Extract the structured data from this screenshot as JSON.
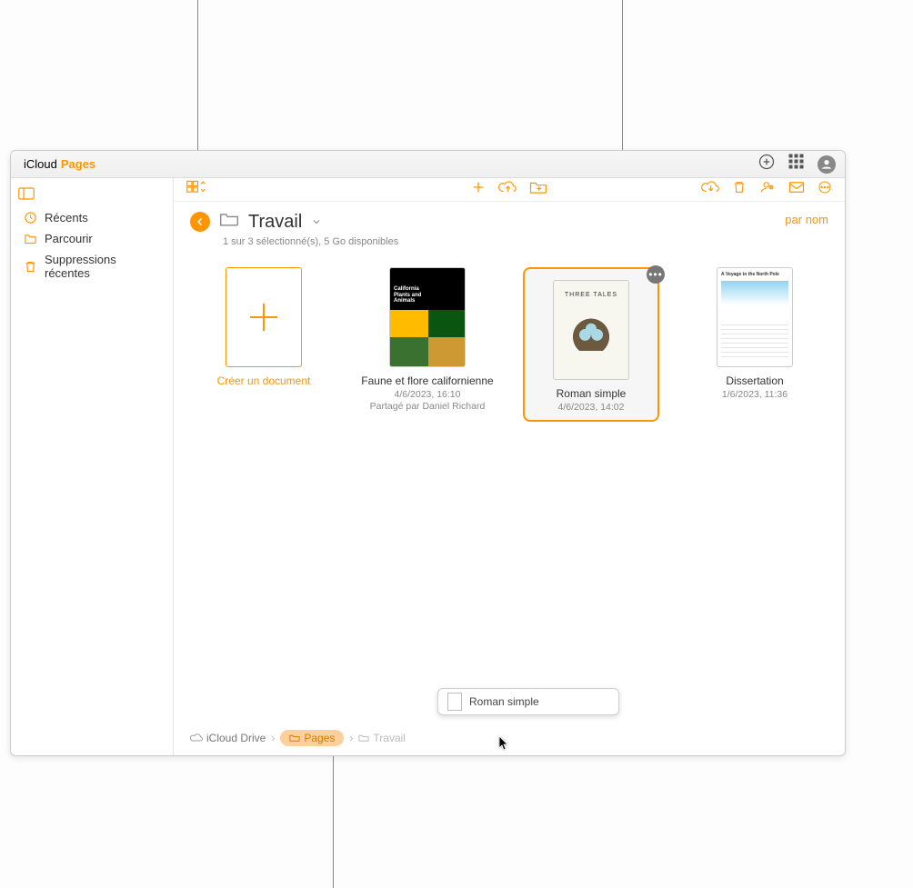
{
  "brand": {
    "icloud": "iCloud",
    "pages": "Pages"
  },
  "sidebar": {
    "recents": "Récents",
    "browse": "Parcourir",
    "deleted": "Suppressions récentes"
  },
  "folder": {
    "name": "Travail",
    "status": "1 sur 3 sélectionné(s), 5 Go disponibles"
  },
  "sort": "par nom",
  "tiles": {
    "create": "Créer un document",
    "faune": {
      "title": "Faune et flore californienne",
      "date": "4/6/2023, 16:10",
      "shared": "Partagé par Daniel Richard",
      "thumb_text": "California Plants and Animals"
    },
    "roman": {
      "title": "Roman simple",
      "date": "4/6/2023, 14:02",
      "thumb_text": "THREE TALES"
    },
    "diss": {
      "title": "Dissertation",
      "date": "1/6/2023, 11:36",
      "thumb_text": "A Voyage to the North Pole"
    }
  },
  "drag": {
    "label": "Roman simple"
  },
  "breadcrumb": {
    "drive": "iCloud Drive",
    "pages": "Pages",
    "current": "Travail"
  }
}
